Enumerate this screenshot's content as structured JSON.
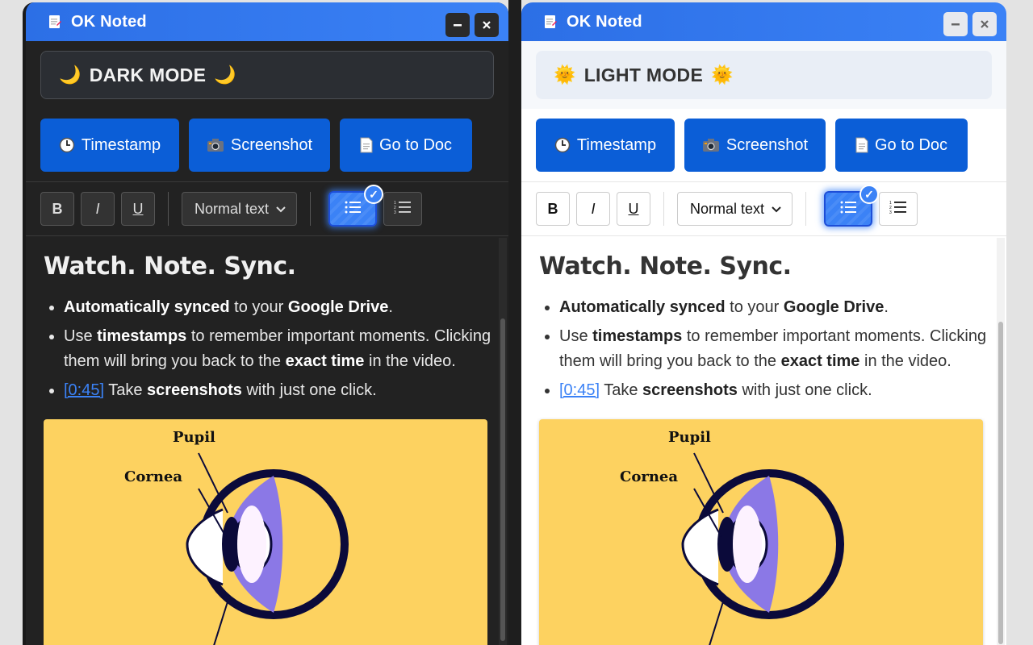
{
  "panels": [
    {
      "title": "OK Noted",
      "mode_label": "DARK MODE",
      "mode_emoji": "🌙",
      "actions": [
        {
          "icon": "clock-icon",
          "label": "Timestamp"
        },
        {
          "icon": "camera-icon",
          "label": "Screenshot"
        },
        {
          "icon": "document-icon",
          "label": "Go to Doc"
        }
      ],
      "toolbar": {
        "bold": "B",
        "italic": "I",
        "underline": "U",
        "style_select": "Normal text"
      },
      "heading": "Watch. Note. Sync.",
      "bullets": {
        "b1_bold": "Automatically synced",
        "b1_text": " to your ",
        "b1_bold2": "Google Drive",
        "b1_end": ".",
        "b2_pre": "Use ",
        "b2_bold": "timestamps",
        "b2_mid": " to remember important moments. Clicking them will bring you back to the ",
        "b2_bold2": "exact time",
        "b2_end": " in the video.",
        "b3_link": "[0:45]",
        "b3_pre": " Take ",
        "b3_bold": "screenshots",
        "b3_end": " with just one click."
      },
      "image_labels": {
        "pupil": "Pupil",
        "cornea": "Cornea"
      }
    },
    {
      "title": "OK Noted",
      "mode_label": "LIGHT MODE",
      "mode_emoji": "🌞",
      "actions": [
        {
          "icon": "clock-icon",
          "label": "Timestamp"
        },
        {
          "icon": "camera-icon",
          "label": "Screenshot"
        },
        {
          "icon": "document-icon",
          "label": "Go to Doc"
        }
      ],
      "toolbar": {
        "bold": "B",
        "italic": "I",
        "underline": "U",
        "style_select": "Normal text"
      },
      "heading": "Watch. Note. Sync.",
      "bullets": {
        "b1_bold": "Automatically synced",
        "b1_text": " to your ",
        "b1_bold2": "Google Drive",
        "b1_end": ".",
        "b2_pre": "Use ",
        "b2_bold": "timestamps",
        "b2_mid": " to remember important moments. Clicking them will bring you back to the ",
        "b2_bold2": "exact time",
        "b2_end": " in the video.",
        "b3_link": "[0:45]",
        "b3_pre": " Take ",
        "b3_bold": "screenshots",
        "b3_end": " with just one click."
      },
      "image_labels": {
        "pupil": "Pupil",
        "cornea": "Cornea"
      }
    }
  ],
  "colors": {
    "accent": "#0b5ed7",
    "title_bar": "#2c6fe6",
    "image_bg": "#fdd260"
  }
}
